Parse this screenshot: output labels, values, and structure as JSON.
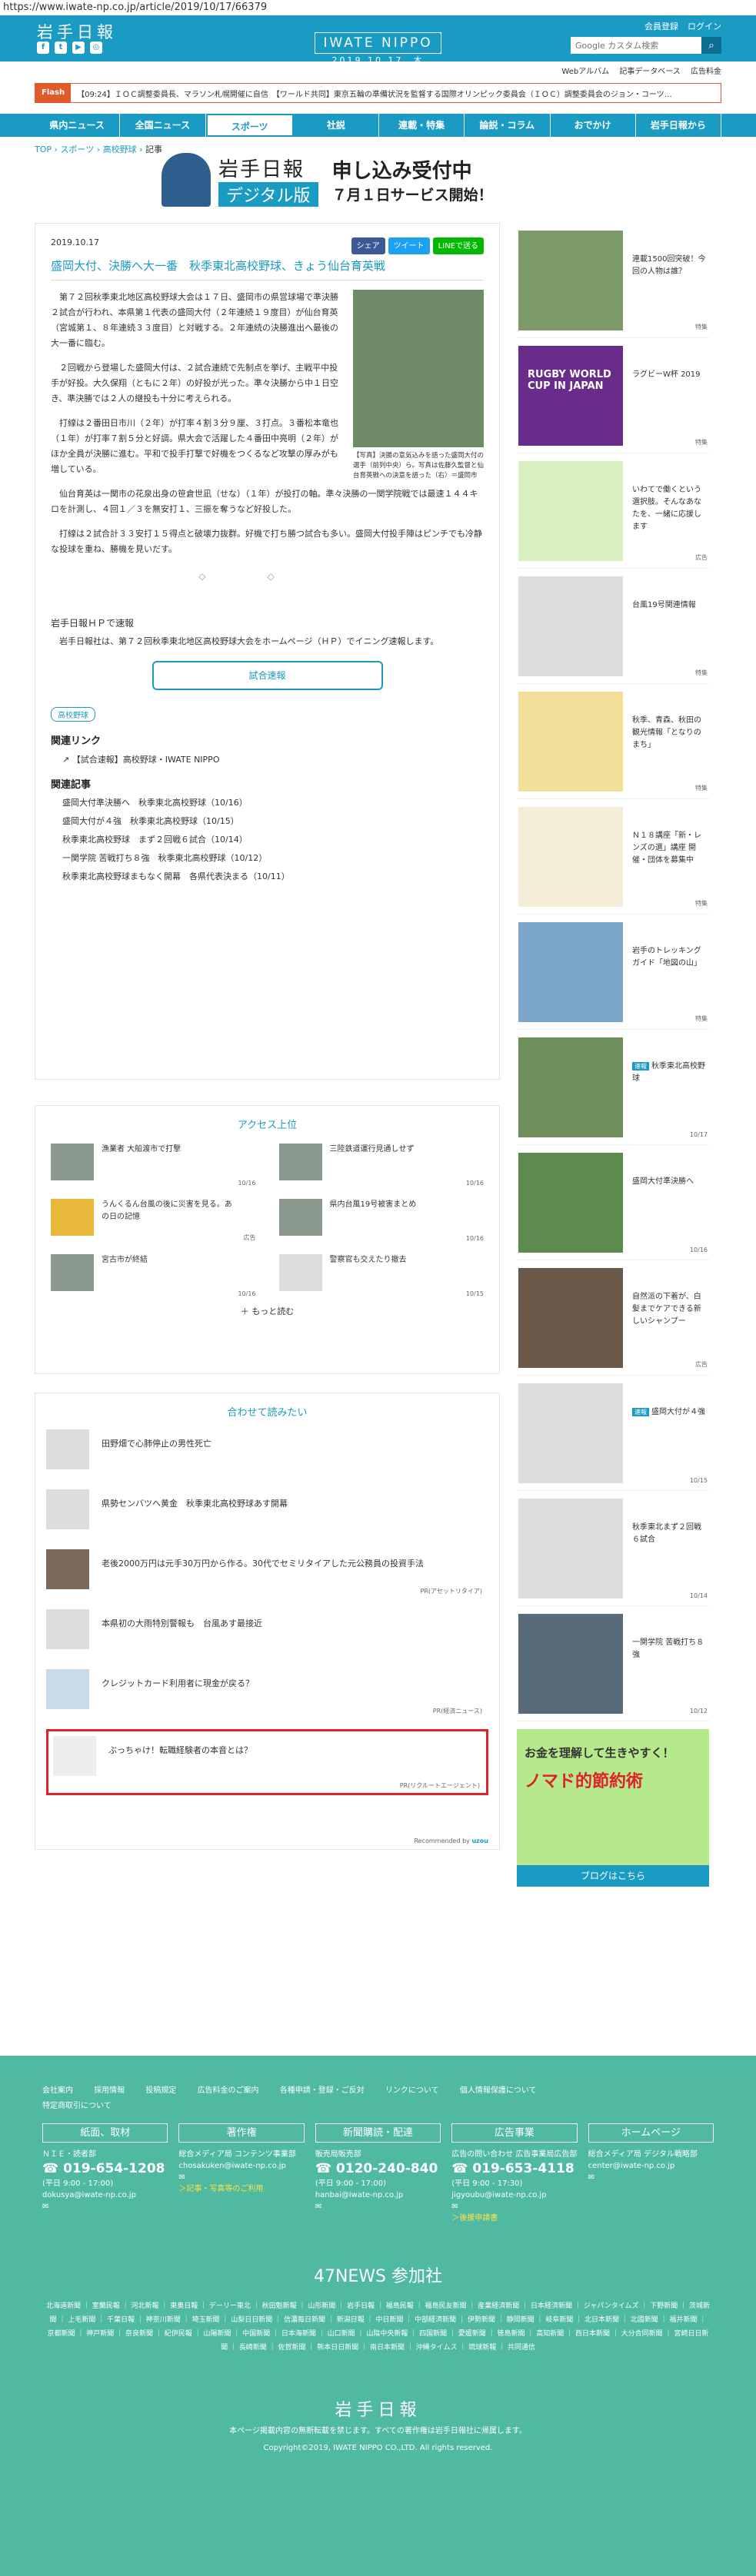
{
  "url": "https://www.iwate-np.co.jp/article/2019/10/17/66379",
  "header": {
    "logo": "岩手日報",
    "brand": "IWATE NIPPO",
    "date": "2019.10.17. 木",
    "member": "会員登録",
    "login": "ログイン",
    "search_placeholder": "Google カスタム検索"
  },
  "sublinks": [
    "Webアルバム",
    "記事データベース",
    "広告料金"
  ],
  "ticker": {
    "label": "Flash",
    "text": "【09:24】ＩＯＣ調整委員長、マラソン札幌開催に自信　【ワールド共同】東京五輪の準備状況を監督する国際オリンピック委員会（ＩＯＣ）調整委員会のジョン・コーツ…"
  },
  "nav": [
    "県内ニュース",
    "全国ニュース",
    "スポーツ",
    "社説",
    "連載・特集",
    "論説・コラム",
    "おでかけ",
    "岩手日報から"
  ],
  "breadcrumb": [
    "TOP",
    "スポーツ",
    "高校野球",
    "記事"
  ],
  "banner": {
    "a": "岩手日報",
    "b": "デジタル版",
    "c": "申し込み受付中",
    "d": "７月１日サービス開始！"
  },
  "article": {
    "date": "2019.10.17",
    "share": [
      "シェア",
      "ツイート",
      "LINEで送る"
    ],
    "title": "盛岡大付、決勝へ大一番　秋季東北高校野球、きょう仙台育英戦",
    "caption": "【写真】決勝の意気込みを語った盛岡大付の選手（前列中央）ら。写真は佐藤久監督と仙台育英戦への決意を語った（右）＝盛岡市",
    "paras": [
      "第７２回秋季東北地区高校野球大会は１７日、盛岡市の県営球場で準決勝２試合が行われ、本県第１代表の盛岡大付（２年連続１９度目）が仙台育英（宮城第１、８年連続３３度目）と対戦する。２年連続の決勝進出へ最後の大一番に臨む。",
      "２回戦から登場した盛岡大付は、２試合連続で先制点を挙げ、主戦平中投手が好投。大久保翔（ともに２年）の好投が光った。準々決勝から中１日空き、準決勝では２人の継投も十分に考えられる。",
      "打線は２番田日市川（２年）が打率４割３分９厘、３打点。３番松本竜也（１年）が打率７割５分と好調。県大会で活躍した４番田中亮明（２年）がほか全員が決勝に進む。平和で投手打撃で好機をつくるなど攻撃の厚みがも増している。",
      "仙台育英は一関市の花泉出身の笹倉世凪（せな）（１年）が投打の軸。準々決勝の一関学院戦では最速１４４キロを計測し、４回１／３を無安打１、三振を奪うなど好投した。",
      "打線は２試合計３３安打１５得点と破壊力抜群。好機で打ち勝つ試合も多い。盛岡大付投手陣はピンチでも冷静な投球を重ね、勝機を見いだす。"
    ],
    "hp_title": "岩手日報ＨＰで速報",
    "hp_text": "岩手日報社は、第７２回秋季東北地区高校野球大会をホームページ（ＨＰ）でイニング速報します。",
    "button": "試合速報",
    "tag": "高校野球",
    "related_links_title": "関連リンク",
    "related_link": "【試合速報】高校野球・IWATE NIPPO",
    "related_title": "関連記事",
    "related": [
      "盛岡大付準決勝へ　秋季東北高校野球（10/16）",
      "盛岡大付が４強　秋季東北高校野球（10/15）",
      "秋季東北高校野球　まず２回戦６試合（10/14）",
      "一関学院 苦戦打ち８強　秋季東北高校野球（10/12）",
      "秋季東北高校野球まもなく開幕　各県代表決まる（10/11）"
    ]
  },
  "access": {
    "title": "アクセス上位",
    "items": [
      {
        "t": "漁業者 大船渡市で打撃",
        "d": "10/16"
      },
      {
        "t": "三陸鉄道運行見通しせず",
        "d": "10/16"
      },
      {
        "t": "うんくるん台風の後に災害を見る。あの日の記憶",
        "d": "広告"
      },
      {
        "t": "県内台風19号被害まとめ",
        "d": "10/16"
      },
      {
        "t": "宮古市が終結",
        "d": "10/16"
      },
      {
        "t": "警察官も交えたり撤去",
        "d": "10/15"
      }
    ],
    "more": "もっと読む"
  },
  "reco": {
    "title": "合わせて読みたい",
    "items": [
      {
        "t": "田野畑で心肺停止の男性死亡",
        "p": ""
      },
      {
        "t": "県勢センバツへ黄金　秋季東北高校野球あす開幕",
        "p": ""
      },
      {
        "t": "老後2000万円は元手30万円から作る。30代でセミリタイアした元公務員の投資手法",
        "p": "PR(アセットリタイア)"
      },
      {
        "t": "本県初の大雨特別警報も　台風あす最接近",
        "p": ""
      },
      {
        "t": "クレジットカード利用者に現金が戻る？",
        "p": "PR(経済ニュース)"
      },
      {
        "t": "ぶっちゃけ！転職経験者の本音とは？",
        "p": "PR(リクルートエージェント)"
      }
    ],
    "rec": "Recommended by"
  },
  "side": [
    {
      "t": "連載1500回突破！今回の人物は誰？",
      "f": "特集"
    },
    {
      "t": "ラグビーW杯 2019",
      "f": "特集",
      "img": "RUGBY WORLD CUP IN JAPAN"
    },
    {
      "t": "いわてで働くという選択肢。そんなあなたを、一緒に応援します",
      "f": "広告"
    },
    {
      "t": "台風19号関連情報",
      "f": "特集"
    },
    {
      "t": "秋季、青森、秋田の観光情報「となりのまち」",
      "f": "特集"
    },
    {
      "t": "Ｎ１８講座「新・レンズの選」講座 開催・団体を募集中",
      "f": "特集"
    },
    {
      "t": "岩手のトレッキングガイド「地図の山」",
      "f": "特集"
    },
    {
      "t": "秋季東北高校野球",
      "f": "10/17",
      "b": "速報"
    },
    {
      "t": "盛岡大付準決勝へ",
      "f": "10/16"
    },
    {
      "t": "自然派の下着が、白髪までケアできる新しいシャンプー",
      "f": "広告"
    },
    {
      "t": "盛岡大付が４強",
      "f": "10/15",
      "b": "速報"
    },
    {
      "t": "秋季東北まず２回戦６試合",
      "f": "10/14"
    },
    {
      "t": "一関学院 苦戦打ち８強",
      "f": "10/12"
    }
  ],
  "side_ad": {
    "a": "お金を理解して生きやすく！",
    "b": "ノマド的節約術",
    "c": "ブログはこちら"
  },
  "footer": {
    "links": [
      "会社案内",
      "採用情報",
      "投稿規定",
      "広告料金のご案内",
      "各種申請・登録・ご反対",
      "リンクについて",
      "個人情報保護について",
      "特定商取引について"
    ],
    "cols": [
      {
        "h": "紙面、取材",
        "l1": "ＮＩＥ・読者部",
        "tel": "019-654-1208",
        "l2": "(平日 9:00 - 17:00)",
        "mail": "dokusya@iwate-np.co.jp",
        "y": ""
      },
      {
        "h": "著作権",
        "l1": "総合メディア局 コンテンツ事業部",
        "tel": "",
        "l2": "",
        "mail": "chosakuken@iwate-np.co.jp",
        "y": "＞記事・写真等のご利用"
      },
      {
        "h": "新聞購読・配達",
        "l1": "販売局販売部",
        "tel": "0120-240-840",
        "l2": "(平日 9:00 - 17:00)",
        "mail": "hanbai@iwate-np.co.jp",
        "y": ""
      },
      {
        "h": "広告事業",
        "l1": "広告の問い合わせ 広告事業局広告部",
        "tel": "019-653-4118",
        "l2": "(平日 9:00 - 17:30)",
        "mail": "jigyoubu@iwate-np.co.jp",
        "y": "＞後援申請書"
      },
      {
        "h": "ホームページ",
        "l1": "総合メディア局 デジタル戦略部",
        "tel": "",
        "l2": "",
        "mail": "center@iwate-np.co.jp",
        "y": ""
      }
    ],
    "news47": "47NEWS 参加社",
    "papers": "北海道新聞 ｜ 室蘭民報 ｜ 河北新報 ｜ 東奥日報 ｜ デーリー東北 ｜ 秋田魁新報 ｜ 山形新聞 ｜ 岩手日報 ｜ 福島民報 ｜ 福島民友新聞 ｜ 産業経済新聞 ｜ 日本経済新聞 ｜ ジャパンタイムズ ｜ 下野新聞 ｜ 茨城新聞 ｜ 上毛新聞 ｜ 千葉日報 ｜ 神奈川新聞 ｜ 埼玉新聞 ｜ 山梨日日新聞 ｜ 信濃毎日新聞 ｜ 新潟日報 ｜ 中日新聞 ｜ 中部経済新聞 ｜ 伊勢新聞 ｜ 静岡新聞 ｜ 岐阜新聞 ｜ 北日本新聞 ｜ 北國新聞 ｜ 福井新聞 ｜ 京都新聞 ｜ 神戸新聞 ｜ 奈良新聞 ｜ 紀伊民報 ｜ 山陽新聞 ｜ 中国新聞 ｜ 日本海新聞 ｜ 山口新聞 ｜ 山陰中央新報 ｜ 四国新聞 ｜ 愛媛新聞 ｜ 徳島新聞 ｜ 高知新聞 ｜ 西日本新聞 ｜ 大分合同新聞 ｜ 宮崎日日新聞 ｜ 長崎新聞 ｜ 佐賀新聞 ｜ 熊本日日新聞 ｜ 南日本新聞 ｜ 沖縄タイムス ｜ 琉球新報 ｜ 共同通信",
    "logo": "岩手日報",
    "notice": "本ページ掲載内容の無断転載を禁じます。すべての著作権は岩手日報社に帰属します。",
    "copy": "Copyright©2019, IWATE NIPPO CO.,LTD. All rights reserved."
  },
  "colors": {
    "accent": "#1a9bc4",
    "footer": "#4fb9a1",
    "ticker": "#e05a2b",
    "highlight": "#e0202a"
  }
}
